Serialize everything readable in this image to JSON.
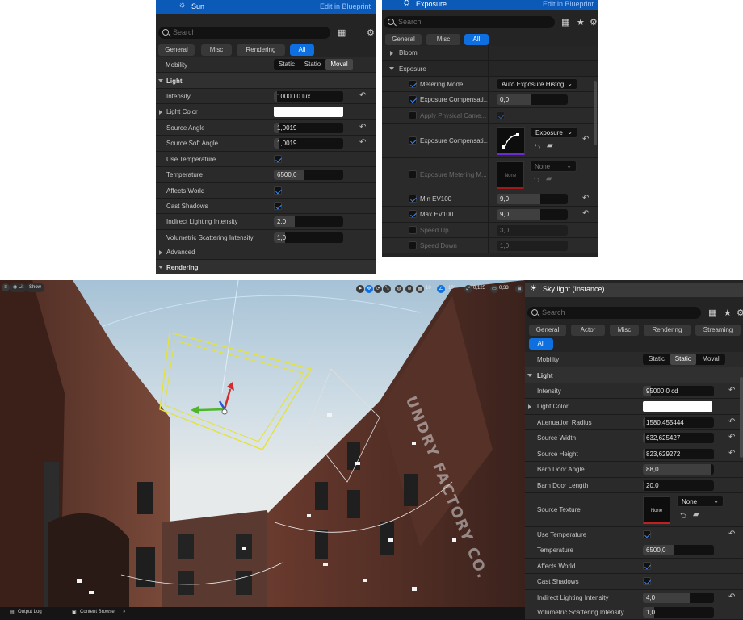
{
  "colors": {
    "accent": "#0d6fe0",
    "panel": "#242424",
    "row": "#2a2a2a",
    "check": "#3b8cff"
  },
  "sun_panel": {
    "actor_name": "Sun",
    "edit_link": "Edit in Blueprint",
    "search_placeholder": "Search",
    "tabs": [
      "General",
      "Misc",
      "Rendering",
      "All"
    ],
    "mobility_label": "Mobility",
    "mobility_options": [
      "Static",
      "Statio",
      "Moval"
    ],
    "light_section": "Light",
    "rows": {
      "intensity": {
        "label": "Intensity",
        "value": "10000,0 lux"
      },
      "light_color": {
        "label": "Light Color"
      },
      "source_angle": {
        "label": "Source Angle",
        "value": "1,0019"
      },
      "source_soft_angle": {
        "label": "Source Soft Angle",
        "value": "1,0019"
      },
      "use_temperature": {
        "label": "Use Temperature"
      },
      "temperature": {
        "label": "Temperature",
        "value": "6500,0"
      },
      "affects_world": {
        "label": "Affects World"
      },
      "cast_shadows": {
        "label": "Cast Shadows"
      },
      "indirect": {
        "label": "Indirect Lighting Intensity",
        "value": "2,0"
      },
      "volumetric": {
        "label": "Volumetric Scattering Intensity",
        "value": "1,0"
      }
    },
    "advanced_section": "Advanced",
    "rendering_section": "Rendering"
  },
  "exposure_panel": {
    "title": "Exposure",
    "edit_link": "Edit in Blueprint",
    "search_placeholder": "Search",
    "tabs": [
      "General",
      "Misc",
      "All"
    ],
    "bloom_section": "Bloom",
    "exposure_section": "Exposure",
    "rows": {
      "metering_mode": {
        "label": "Metering Mode",
        "value": "Auto Exposure Histog"
      },
      "exp_comp": {
        "label": "Exposure Compensati...",
        "value": "0,0"
      },
      "apply_phys": {
        "label": "Apply Physical Came..."
      },
      "exp_comp_curve": {
        "label": "Exposure Compensati...",
        "value": "Exposure"
      },
      "metering_mask": {
        "label": "Exposure Metering M...",
        "value": "None",
        "thumb": "None"
      },
      "min_ev": {
        "label": "Min EV100",
        "value": "9,0"
      },
      "max_ev": {
        "label": "Max EV100",
        "value": "9,0"
      },
      "speed_up": {
        "label": "Speed Up",
        "value": "3,0"
      },
      "speed_down": {
        "label": "Speed Down",
        "value": "1,0"
      }
    }
  },
  "viewport": {
    "lit_button": "Lit",
    "show_button": "Show",
    "snap_grid": "10",
    "snap_angle": "10°",
    "snap_scale": "0,125",
    "camera_speed": "0,33",
    "sign_text": "UNDRY FACTORY CO."
  },
  "statusbar": {
    "output_log": "Output Log",
    "content_browser": "Content Browser",
    "close": "×"
  },
  "skylight_panel": {
    "title": "Sky light (Instance)",
    "search_placeholder": "Search",
    "tabs": [
      "General",
      "Actor",
      "Misc",
      "Rendering",
      "Streaming",
      "All"
    ],
    "mobility_label": "Mobility",
    "mobility_options": [
      "Static",
      "Statio",
      "Moval"
    ],
    "light_section": "Light",
    "rows": {
      "intensity": {
        "label": "Intensity",
        "value": "95000,0 cd"
      },
      "light_color": {
        "label": "Light Color"
      },
      "attenuation": {
        "label": "Attenuation Radius",
        "value": "1580,455444"
      },
      "source_width": {
        "label": "Source Width",
        "value": "632,625427"
      },
      "source_height": {
        "label": "Source Height",
        "value": "823,629272"
      },
      "barn_angle": {
        "label": "Barn Door Angle",
        "value": "88,0"
      },
      "barn_length": {
        "label": "Barn Door Length",
        "value": "20,0"
      },
      "source_texture": {
        "label": "Source Texture",
        "value": "None",
        "thumb": "None"
      },
      "use_temperature": {
        "label": "Use Temperature"
      },
      "temperature": {
        "label": "Temperature",
        "value": "6500,0"
      },
      "affects_world": {
        "label": "Affects World"
      },
      "cast_shadows": {
        "label": "Cast Shadows"
      },
      "indirect": {
        "label": "Indirect Lighting Intensity",
        "value": "4,0"
      },
      "volumetric": {
        "label": "Volumetric Scattering Intensity",
        "value": "1,0"
      }
    }
  }
}
